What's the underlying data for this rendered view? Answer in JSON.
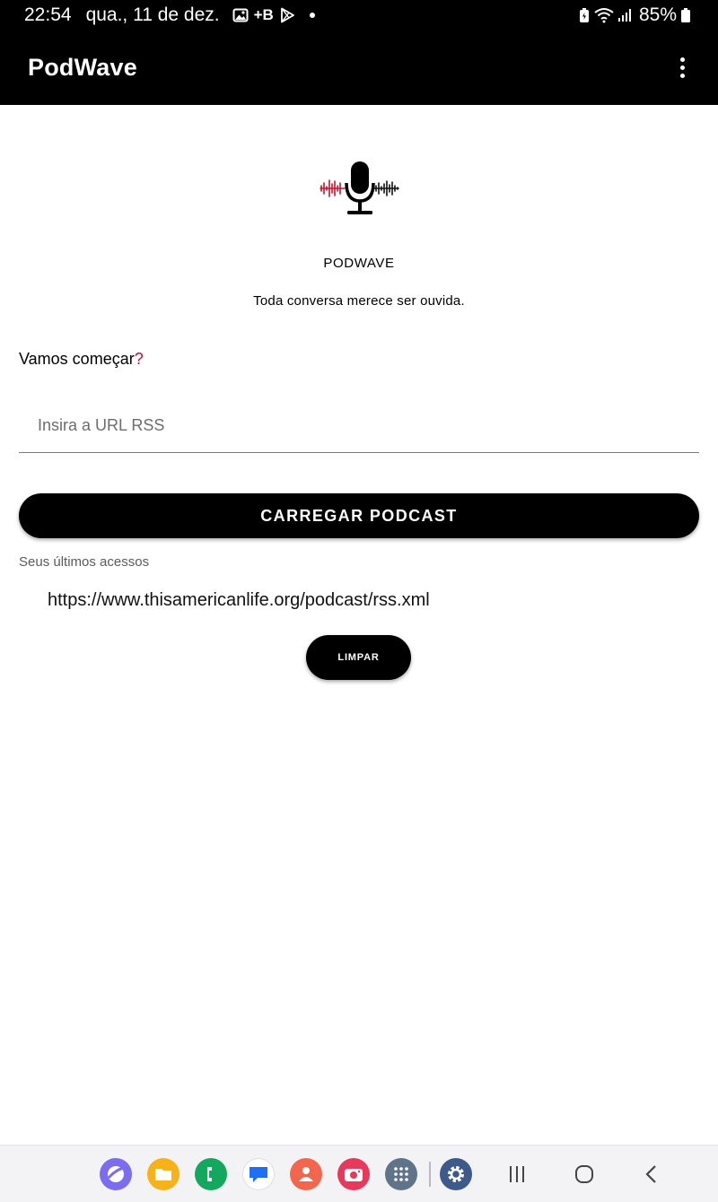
{
  "status_bar": {
    "time": "22:54",
    "date": "qua., 11 de dez.",
    "notification_text": "+B",
    "battery": "85%"
  },
  "app_bar": {
    "title": "PodWave"
  },
  "brand": {
    "name": "PODWAVE",
    "tagline": "Toda conversa merece ser ouvida."
  },
  "main": {
    "heading": "Vamos começar",
    "heading_mark": "?",
    "url_placeholder": "Insira a URL RSS",
    "url_value": "",
    "load_button_label": "CARREGAR PODCAST",
    "recent_label": "Seus últimos acessos",
    "recent_items": [
      "https://www.thisamericanlife.org/podcast/rss.xml"
    ],
    "clear_button_label": "LIMPAR"
  },
  "colors": {
    "bar_background": "#000000",
    "accent_red": "#c8102e",
    "button_background": "#000000",
    "button_text": "#ffffff"
  },
  "taskbar": {
    "apps": [
      {
        "icon": "internet-browser-icon",
        "color": "#7b6cf0"
      },
      {
        "icon": "my-files-icon",
        "color": "#f7b21a"
      },
      {
        "icon": "phone-icon",
        "color": "#14a85e"
      },
      {
        "icon": "messages-icon",
        "color": "#ffffff"
      },
      {
        "icon": "contacts-icon",
        "color": "#f2664d"
      },
      {
        "icon": "camera-icon",
        "color": "#e8385b"
      },
      {
        "icon": "apps-grid-icon",
        "color": "#5f7389"
      },
      {
        "icon": "settings-icon",
        "color": "#3d5a8a"
      }
    ],
    "nav": [
      "recents-icon",
      "home-icon",
      "back-icon"
    ]
  }
}
